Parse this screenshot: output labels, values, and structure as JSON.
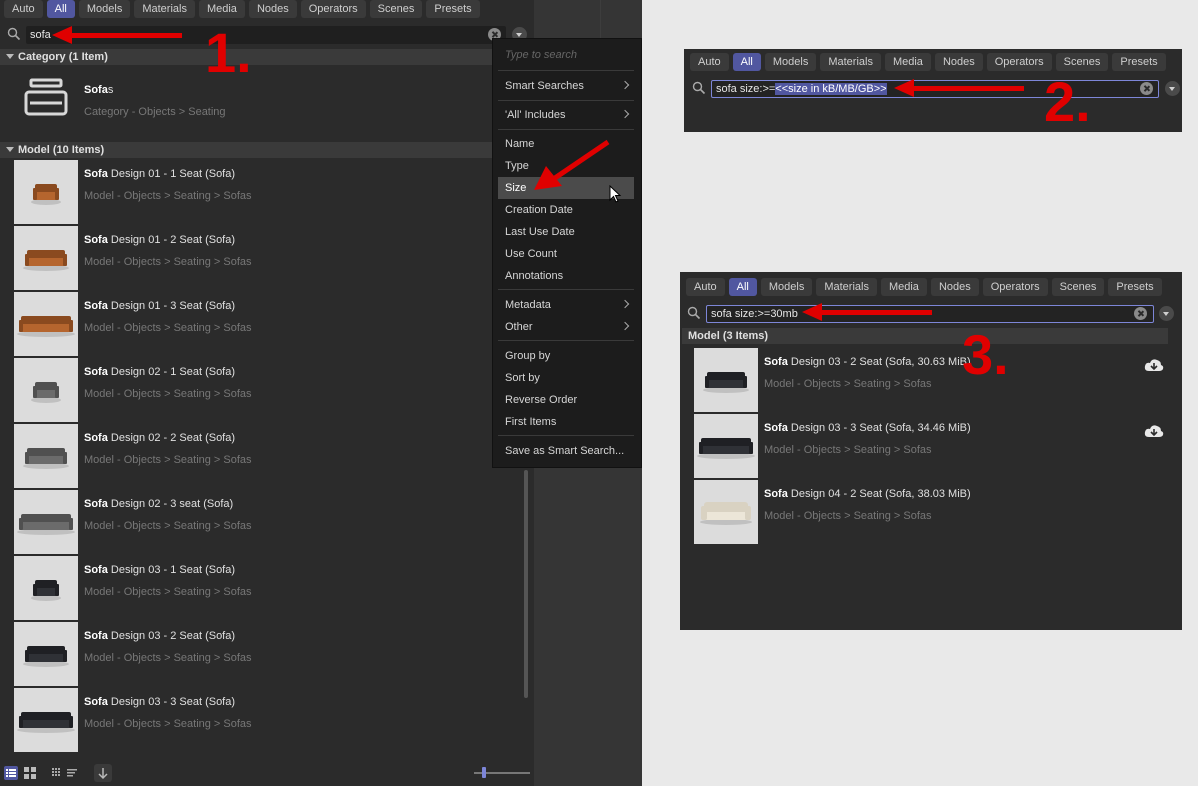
{
  "tabs": [
    "Auto",
    "All",
    "Models",
    "Materials",
    "Media",
    "Nodes",
    "Operators",
    "Scenes",
    "Presets"
  ],
  "active_tab": "All",
  "main": {
    "search_value": "sofa",
    "category_header": "Category (1 Item)",
    "category_item": {
      "bold": "Sofa",
      "rest": "s",
      "path": "Category - Objects > Seating"
    },
    "model_header": "Model (10 Items)",
    "items": [
      {
        "bold": "Sofa",
        "rest": " Design 01 - 1 Seat (Sofa)",
        "path": "Model - Objects > Seating > Sofas"
      },
      {
        "bold": "Sofa",
        "rest": " Design 01 - 2 Seat (Sofa)",
        "path": "Model - Objects > Seating > Sofas"
      },
      {
        "bold": "Sofa",
        "rest": " Design 01 - 3 Seat (Sofa)",
        "path": "Model - Objects > Seating > Sofas"
      },
      {
        "bold": "Sofa",
        "rest": " Design 02 - 1 Seat (Sofa)",
        "path": "Model - Objects > Seating > Sofas"
      },
      {
        "bold": "Sofa",
        "rest": " Design 02 - 2 Seat (Sofa)",
        "path": "Model - Objects > Seating > Sofas"
      },
      {
        "bold": "Sofa",
        "rest": " Design 02 - 3 seat (Sofa)",
        "path": "Model - Objects > Seating > Sofas"
      },
      {
        "bold": "Sofa",
        "rest": " Design 03 - 1 Seat (Sofa)",
        "path": "Model - Objects > Seating > Sofas"
      },
      {
        "bold": "Sofa",
        "rest": " Design 03 - 2 Seat (Sofa)",
        "path": "Model - Objects > Seating > Sofas"
      },
      {
        "bold": "Sofa",
        "rest": " Design 03 - 3 Seat (Sofa)",
        "path": "Model - Objects > Seating > Sofas"
      }
    ]
  },
  "menu": {
    "placeholder": "Type to search",
    "items": [
      "Smart Searches",
      "'All' Includes",
      "Name",
      "Type",
      "Size",
      "Creation Date",
      "Last Use Date",
      "Use Count",
      "Annotations",
      "Metadata",
      "Other",
      "Group by",
      "Sort by",
      "Reverse Order",
      "First Items",
      "Save as Smart Search..."
    ],
    "selected": "Size"
  },
  "panel2": {
    "search_prefix": "sofa size:>=",
    "search_highlight": "<<size in kB/MB/GB>>"
  },
  "panel3": {
    "search_value": "sofa size:>=30mb",
    "model_header": "Model (3 Items)",
    "items": [
      {
        "bold": "Sofa",
        "rest": " Design 03 - 2 Seat (Sofa, 30.63 MiB)",
        "path": "Model - Objects > Seating > Sofas"
      },
      {
        "bold": "Sofa",
        "rest": " Design 03 - 3 Seat (Sofa, 34.46 MiB)",
        "path": "Model - Objects > Seating > Sofas"
      },
      {
        "bold": "Sofa",
        "rest": " Design 04 - 2 Seat (Sofa, 38.03 MiB)",
        "path": "Model - Objects > Seating > Sofas"
      }
    ]
  },
  "steps": [
    "1.",
    "2.",
    "3."
  ],
  "colors": {
    "accent": "#5157a0",
    "arrow": "#e00000",
    "panel": "#2b2b2b"
  }
}
